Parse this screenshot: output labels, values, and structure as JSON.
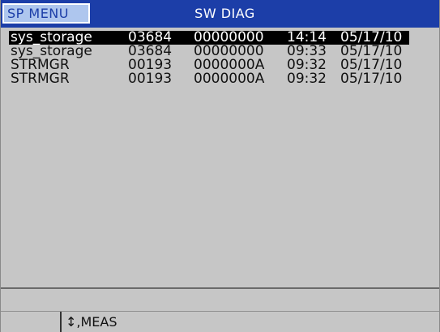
{
  "header": {
    "menu_label": "SP MENU",
    "title": "SW DIAG"
  },
  "log": {
    "rows": [
      {
        "name": "sys_storage",
        "num": "03684",
        "code": "00000000",
        "time": "14:14",
        "date": "05/17/10",
        "selected": true
      },
      {
        "name": "sys_storage",
        "num": "03684",
        "code": "00000000",
        "time": "09:33",
        "date": "05/17/10",
        "selected": false
      },
      {
        "name": "STRMGR",
        "num": "00193",
        "code": "0000000A",
        "time": "09:32",
        "date": "05/17/10",
        "selected": false
      },
      {
        "name": "STRMGR",
        "num": "00193",
        "code": "0000000A",
        "time": "09:32",
        "date": "05/17/10",
        "selected": false
      }
    ]
  },
  "footer": {
    "status_text": "",
    "softkey_arrow": "↕",
    "softkey_hint": ",MEAS"
  },
  "colors": {
    "title_bar": "#1c3ea8",
    "menu_tab": "#aec6ee",
    "screen_bg": "#c6c6c6",
    "selection": "#000000"
  }
}
